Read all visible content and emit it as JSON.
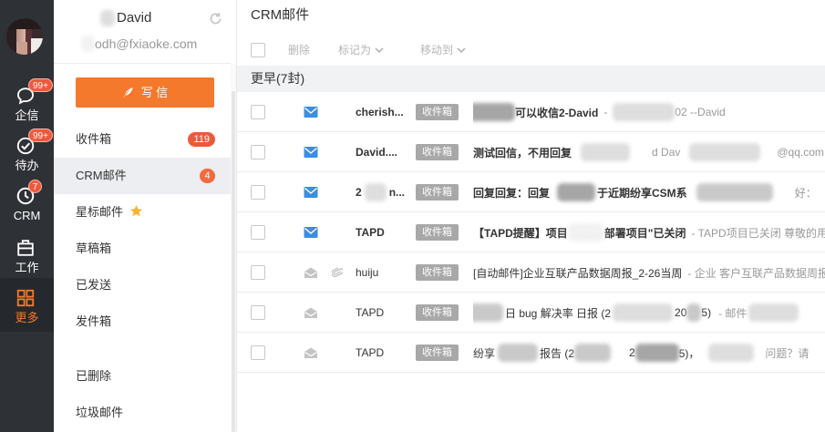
{
  "nav": {
    "items": [
      {
        "label": "企信",
        "badge": "99+",
        "icon": "chat-icon"
      },
      {
        "label": "待办",
        "badge": "99+",
        "icon": "check-circle-icon"
      },
      {
        "label": "CRM",
        "badge": "7",
        "icon": "clock-icon"
      },
      {
        "label": "工作",
        "badge": "",
        "icon": "briefcase-icon"
      },
      {
        "label": "更多",
        "badge": "",
        "icon": "grid-icon",
        "active": true
      }
    ]
  },
  "account": {
    "name": "David",
    "email": "odh@fxiaoke.com",
    "refresh_icon": "refresh-icon"
  },
  "compose": {
    "label": "写 信",
    "icon": "feather-pen-icon"
  },
  "folders": [
    {
      "label": "收件箱",
      "badge": "119"
    },
    {
      "label": "CRM邮件",
      "badge": "4",
      "active": true
    },
    {
      "label": "星标邮件",
      "icon": "star-icon"
    },
    {
      "label": "草稿箱"
    },
    {
      "label": "已发送"
    },
    {
      "label": "发件箱"
    },
    {
      "label": "已删除"
    },
    {
      "label": "垃圾邮件"
    }
  ],
  "main": {
    "title": "CRM邮件",
    "toolbar": {
      "delete": "删除",
      "mark_as": "标记为",
      "move_to": "移动到"
    },
    "group_label": "更早(7封)"
  },
  "mails": [
    {
      "sender": [
        "cherish..."
      ],
      "tag": "收件箱",
      "unread": true,
      "attachment": false,
      "subject": [
        "可以收信2-David"
      ],
      "preview": [
        "-",
        "02 --David"
      ]
    },
    {
      "sender": [
        "David...."
      ],
      "tag": "收件箱",
      "unread": true,
      "attachment": false,
      "subject": [
        "测试回信，不用回复"
      ],
      "preview": [
        "d Dav",
        "@qq.com"
      ]
    },
    {
      "sender": [
        "2",
        "n..."
      ],
      "tag": "收件箱",
      "unread": true,
      "attachment": false,
      "subject": [
        "回复回复：回复",
        "于近期纷享CSM系"
      ],
      "preview": [
        "好："
      ]
    },
    {
      "sender": [
        "TAPD"
      ],
      "tag": "收件箱",
      "unread": true,
      "attachment": false,
      "subject": [
        "【TAPD提醒】项目",
        "部署项目\"已关闭"
      ],
      "preview": [
        "- TAPD项目已关闭 尊敬的用"
      ]
    },
    {
      "sender": [
        "huiju"
      ],
      "tag": "收件箱",
      "unread": false,
      "attachment": true,
      "subject": [
        "[自动邮件]企业互联产品数据周报_2-26当周"
      ],
      "preview": [
        "- 企业 客户互联产品数据周报"
      ]
    },
    {
      "sender": [
        "TAPD"
      ],
      "tag": "收件箱",
      "unread": false,
      "attachment": false,
      "subject": [
        "日 bug 解决率 日报 (2",
        "20",
        "5)"
      ],
      "preview": [
        "- 邮件"
      ]
    },
    {
      "sender": [
        "TAPD"
      ],
      "tag": "收件箱",
      "unread": false,
      "attachment": false,
      "subject": [
        "纷享",
        "报告 (2",
        "2",
        "5)，"
      ],
      "preview": [
        "问题？请"
      ]
    }
  ],
  "colors": {
    "accent": "#f5792c",
    "nav_bg": "#2e3136",
    "badge_red": "#f0583c",
    "unread_icon": "#3b8ee0",
    "tag_bg": "#a8a8a8",
    "group_bg": "#f1f2f4"
  }
}
